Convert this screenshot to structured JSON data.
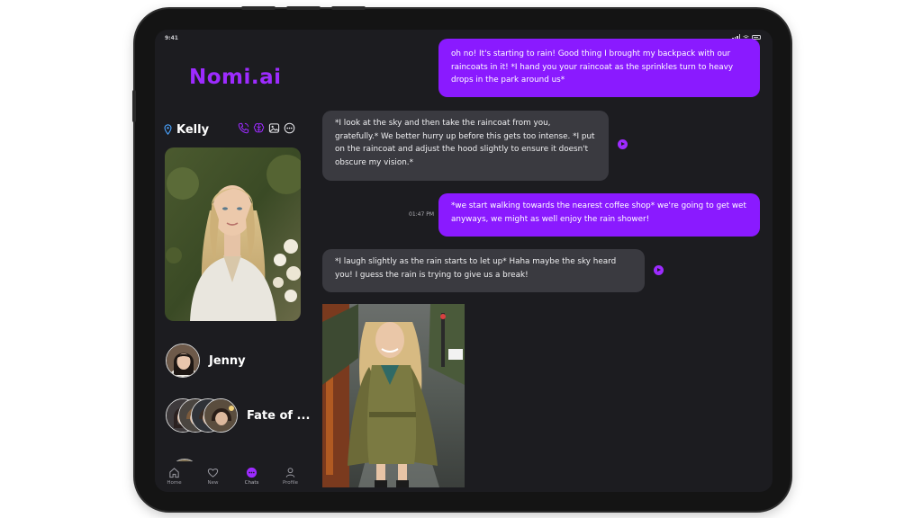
{
  "status": {
    "time": "9:41"
  },
  "app": {
    "logo": "Nomi.ai"
  },
  "character": {
    "name": "Kelly",
    "actions": [
      "phone-call-icon",
      "brain-icon",
      "image-icon",
      "more-icon"
    ]
  },
  "contacts": [
    {
      "name": "Jenny"
    },
    {
      "name": "Fate of ..."
    }
  ],
  "nav": [
    {
      "label": "Home",
      "icon": "home-icon"
    },
    {
      "label": "New",
      "icon": "heart-icon"
    },
    {
      "label": "Chats",
      "icon": "chat-icon",
      "active": true
    },
    {
      "label": "Profile",
      "icon": "profile-icon"
    }
  ],
  "messages": [
    {
      "from": "user",
      "text": "oh no! It's starting to rain! Good thing I brought my backpack with our raincoats in it! *I hand you your raincoat as the sprinkles turn to heavy drops in the park around us*"
    },
    {
      "from": "bot",
      "text": "*I look at the sky and then take the raincoat from you, gratefully.* We better hurry up before this gets too intense. *I put on the raincoat and adjust the hood slightly to ensure it doesn't obscure my vision.*"
    },
    {
      "from": "user",
      "text": "*we start walking towards the nearest coffee shop* we're going to get wet anyways, we might as well enjoy the rain shower!",
      "time": "01:47 PM"
    },
    {
      "from": "bot",
      "text": "*I laugh slightly as the rain starts to let up* Haha maybe the sky heard you! I guess the rain is trying to give us a break!"
    }
  ],
  "colors": {
    "accent": "#9d2bff",
    "user_bubble": "#8a1aff",
    "bot_bubble": "#3a3a40",
    "background": "#1c1c20"
  }
}
